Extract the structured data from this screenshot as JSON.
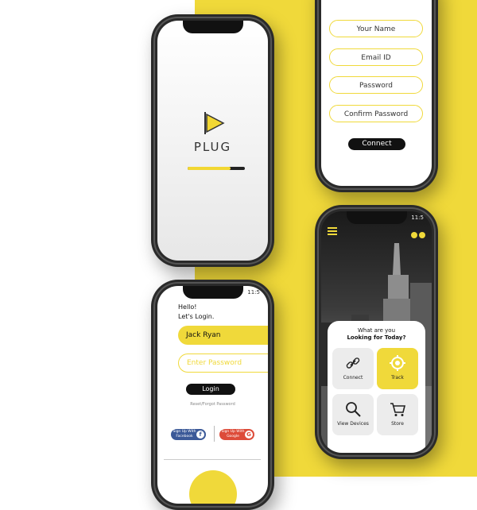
{
  "colors": {
    "accent": "#f0d93a",
    "dark": "#111111"
  },
  "splash": {
    "brand": "PLUG",
    "progress": 0.75,
    "logo_icon": "play-logo-icon"
  },
  "signup": {
    "fields": [
      "Your Name",
      "Email ID",
      "Password",
      "Confirm Password"
    ],
    "connect_label": "Connect"
  },
  "login": {
    "status_time": "11:5",
    "greeting_line1": "Hello!",
    "greeting_line2": "Let's Login.",
    "name_value": "Jack Ryan",
    "password_placeholder": "Enter Password",
    "login_label": "Login",
    "reset_label": "Reset/Forgot Password",
    "facebook_label_1": "Sign Up With",
    "facebook_label_2": "Facebook",
    "google_label_1": "Sign Up With",
    "google_label_2": "Google"
  },
  "dashboard": {
    "status_time": "11:5",
    "question_line1": "What are you",
    "question_line2": "Looking for Today?",
    "tiles": [
      {
        "label": "Connect",
        "icon": "link-icon",
        "active": false
      },
      {
        "label": "Track",
        "icon": "target-icon",
        "active": true
      },
      {
        "label": "View Devices",
        "icon": "search-icon",
        "active": false
      },
      {
        "label": "Store",
        "icon": "cart-icon",
        "active": false
      }
    ]
  }
}
